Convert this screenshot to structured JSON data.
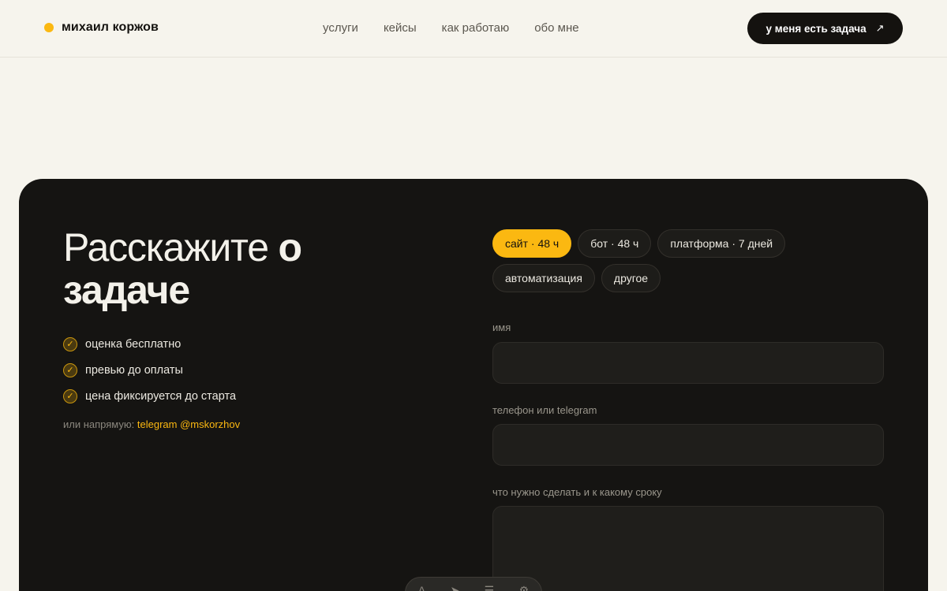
{
  "header": {
    "logo_text": "михаил коржов",
    "nav": [
      "услуги",
      "кейсы",
      "как работаю",
      "обо мне"
    ],
    "cta_label": "у меня есть задача",
    "cta_icon": "arrow-up-right-icon",
    "accent": "#fbb811"
  },
  "form_section": {
    "title_light": "Расскажите",
    "title_bold_1": "о",
    "title_bold_2": "задаче",
    "checks": [
      "оценка бесплатно",
      "превью до оплаты",
      "цена фиксируется до старта"
    ],
    "direct_prefix": "или напрямую:",
    "direct_link": "telegram @mskorzhov",
    "chips": [
      {
        "label": "сайт · 48 ч",
        "active": true
      },
      {
        "label": "бот · 48 ч",
        "active": false
      },
      {
        "label": "платформа · 7 дней",
        "active": false
      },
      {
        "label": "автоматизация",
        "active": false
      },
      {
        "label": "другое",
        "active": false
      }
    ],
    "fields": {
      "name_label": "имя",
      "name_value": "",
      "contact_label": "телефон или telegram",
      "contact_value": "",
      "task_label": "что нужно сделать и к какому сроку",
      "task_value": ""
    }
  },
  "toolbar": {
    "icons": [
      "text-icon",
      "pointer-icon",
      "comment-icon",
      "settings-icon"
    ]
  }
}
